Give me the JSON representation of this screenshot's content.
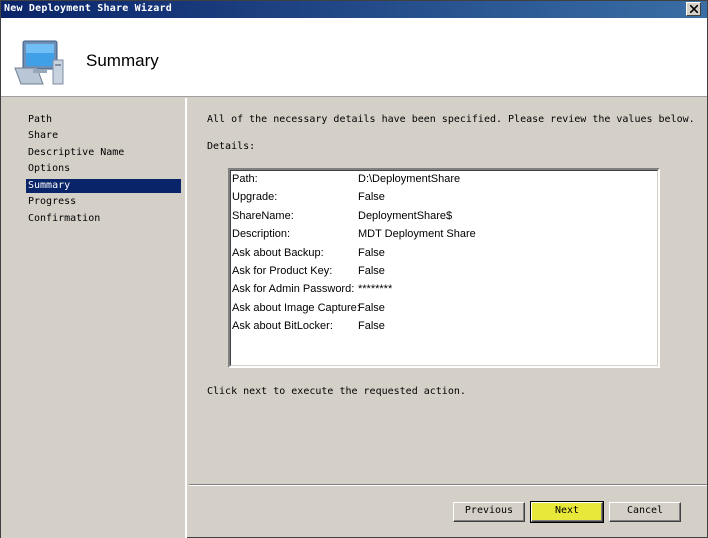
{
  "window": {
    "title": "New Deployment Share Wizard"
  },
  "header": {
    "title": "Summary"
  },
  "nav": {
    "items": [
      {
        "label": "Path"
      },
      {
        "label": "Share"
      },
      {
        "label": "Descriptive Name"
      },
      {
        "label": "Options"
      },
      {
        "label": "Summary",
        "selected": true
      },
      {
        "label": "Progress"
      },
      {
        "label": "Confirmation"
      }
    ]
  },
  "main": {
    "intro": "All of the necessary details have been specified.  Please review the values below.",
    "details_label": "Details:",
    "details": [
      {
        "key": "Path:",
        "value": "D:\\DeploymentShare"
      },
      {
        "key": "Upgrade:",
        "value": "False"
      },
      {
        "key": "ShareName:",
        "value": "DeploymentShare$"
      },
      {
        "key": "Description:",
        "value": "MDT Deployment Share"
      },
      {
        "key": "Ask about Backup:",
        "value": "False"
      },
      {
        "key": "Ask for Product Key:",
        "value": "False"
      },
      {
        "key": "Ask for Admin Password:",
        "value": "********"
      },
      {
        "key": "Ask about Image Capture:",
        "value": "False"
      },
      {
        "key": "Ask about BitLocker:",
        "value": "False"
      }
    ],
    "outro": "Click next to execute the requested action."
  },
  "buttons": {
    "previous": "Previous",
    "next": "Next",
    "cancel": "Cancel"
  },
  "colors": {
    "titlebar": "#0a246a",
    "selected": "#0a246a",
    "primary_button": "#e8e83a",
    "face": "#d4d0c8"
  }
}
